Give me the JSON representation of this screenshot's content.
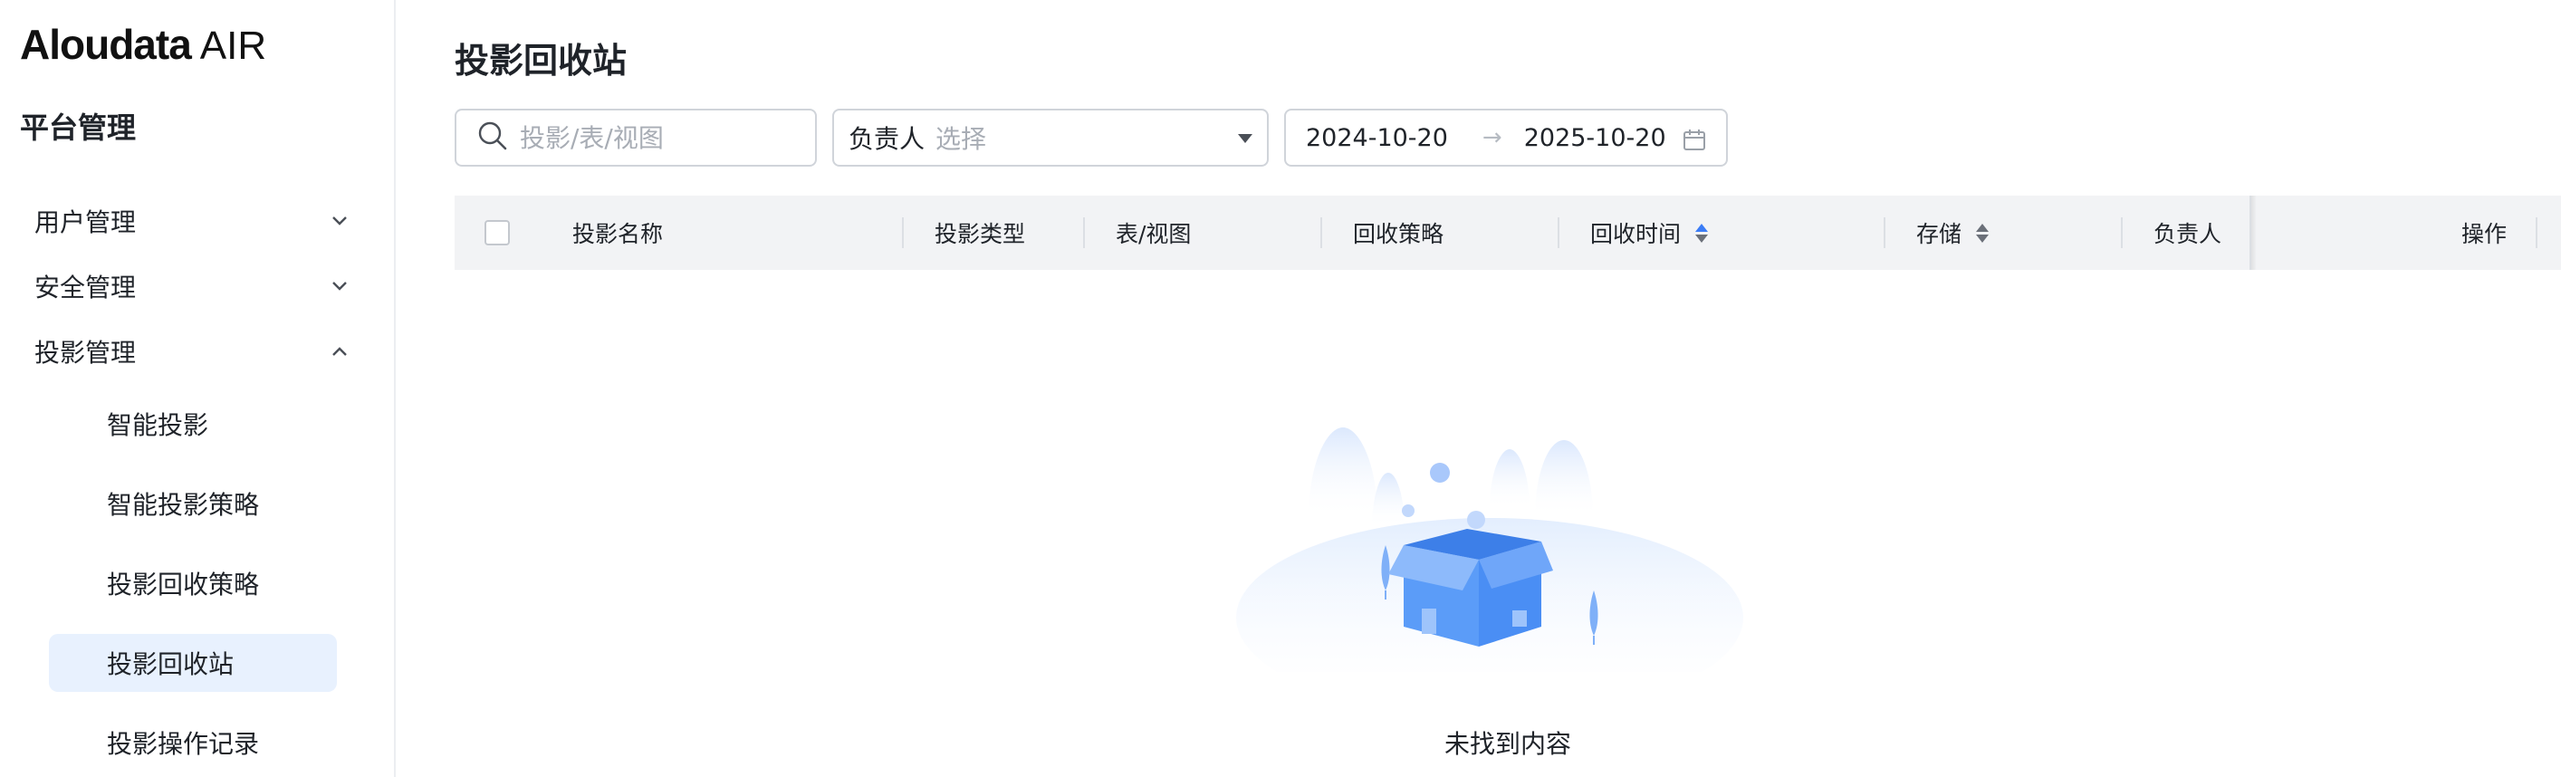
{
  "brand": {
    "name": "Aloudata",
    "suffix": "AIR"
  },
  "sidebar": {
    "title": "平台管理",
    "groups": [
      {
        "label": "用户管理",
        "expanded": false
      },
      {
        "label": "安全管理",
        "expanded": false
      },
      {
        "label": "投影管理",
        "expanded": true
      }
    ],
    "subitems": [
      {
        "label": "智能投影"
      },
      {
        "label": "智能投影策略"
      },
      {
        "label": "投影回收策略"
      },
      {
        "label": "投影回收站",
        "active": true
      },
      {
        "label": "投影操作记录"
      }
    ]
  },
  "page": {
    "title": "投影回收站"
  },
  "filters": {
    "search_placeholder": "投影/表/视图",
    "owner_prefix": "负责人",
    "owner_placeholder": "选择",
    "date_start": "2024-10-20",
    "date_arrow": "→",
    "date_end": "2025-10-20"
  },
  "table": {
    "columns": [
      {
        "label": "投影名称"
      },
      {
        "label": "投影类型"
      },
      {
        "label": "表/视图"
      },
      {
        "label": "回收策略"
      },
      {
        "label": "回收时间",
        "sortable": true,
        "sort": "asc"
      },
      {
        "label": "存储",
        "sortable": true
      },
      {
        "label": "负责人"
      },
      {
        "label": "操作"
      }
    ],
    "rows": []
  },
  "empty_state": {
    "text": "未找到内容"
  },
  "colors": {
    "accent": "#3b7cf6",
    "active_bg": "#e8f1fe",
    "header_bg": "#f2f3f5",
    "illustration_blue": "#5b9cf8"
  }
}
